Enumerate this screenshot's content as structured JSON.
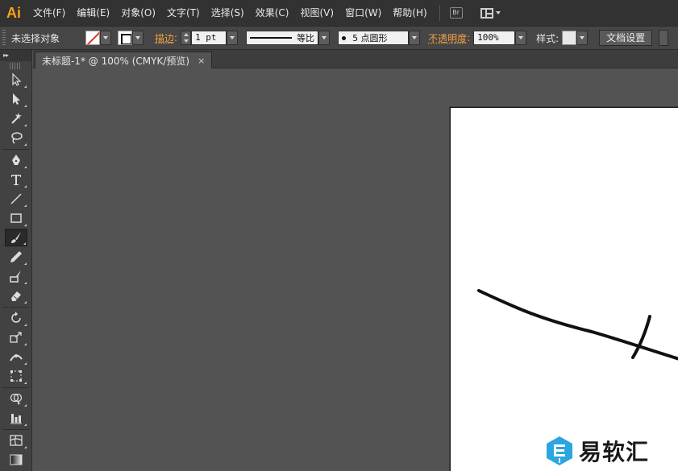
{
  "app": {
    "logo": "Ai"
  },
  "menu": {
    "items": [
      "文件(F)",
      "编辑(E)",
      "对象(O)",
      "文字(T)",
      "选择(S)",
      "效果(C)",
      "视图(V)",
      "窗口(W)",
      "帮助(H)"
    ],
    "bridge_label": "Br"
  },
  "control": {
    "selection_label": "未选择对象",
    "stroke_link": "描边",
    "stroke_weight": "1 pt",
    "profile_label": "等比",
    "brush_label": "5 点圆形",
    "opacity_link": "不透明度",
    "opacity_value": "100%",
    "style_label": "样式:",
    "doc_setup_button": "文档设置"
  },
  "document": {
    "tab_title": "未标题-1* @ 100% (CMYK/预览)",
    "close_glyph": "×"
  },
  "watermark": {
    "text": "易软汇"
  },
  "colors": {
    "accent_logo": "#f7a21b",
    "link_orange": "#f2a143",
    "watermark_blue": "#2aa6e0"
  }
}
